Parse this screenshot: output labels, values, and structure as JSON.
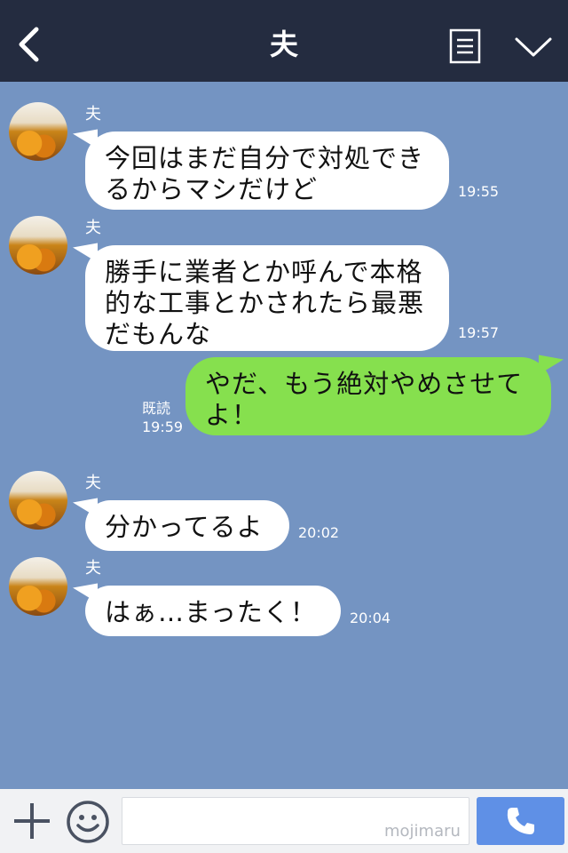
{
  "header": {
    "title": "夫",
    "back_icon": "chevron-left-icon",
    "menu_icon": "document-menu-icon",
    "more_icon": "chevron-down-icon",
    "background": "#242c40"
  },
  "chat": {
    "background": "#7494c2",
    "messages": [
      {
        "side": "in",
        "sender": "夫",
        "lines": [
          "今回はまだ自分で対処でき",
          "るからマシだけど"
        ],
        "time": "19:55"
      },
      {
        "side": "in",
        "sender": "夫",
        "lines": [
          "勝手に業者とか呼んで本格",
          "的な工事とかされたら最悪",
          "だもんな"
        ],
        "time": "19:57"
      },
      {
        "side": "out",
        "read_label": "既読",
        "lines": [
          "やだ、もう絶対やめさせて",
          "よ！"
        ],
        "time": "19:59"
      },
      {
        "side": "in",
        "sender": "夫",
        "lines": [
          "分かってるよ"
        ],
        "time": "20:02"
      },
      {
        "side": "in",
        "sender": "夫",
        "lines": [
          "はぁ…まったく！"
        ],
        "time": "20:04"
      }
    ]
  },
  "inputbar": {
    "plus_icon": "plus-icon",
    "emoji_icon": "smiley-icon",
    "watermark": "mojimaru",
    "call_icon": "phone-icon",
    "call_color": "#5f90e6"
  },
  "colors": {
    "outgoing_bubble": "#86e04e",
    "incoming_bubble": "#ffffff"
  }
}
